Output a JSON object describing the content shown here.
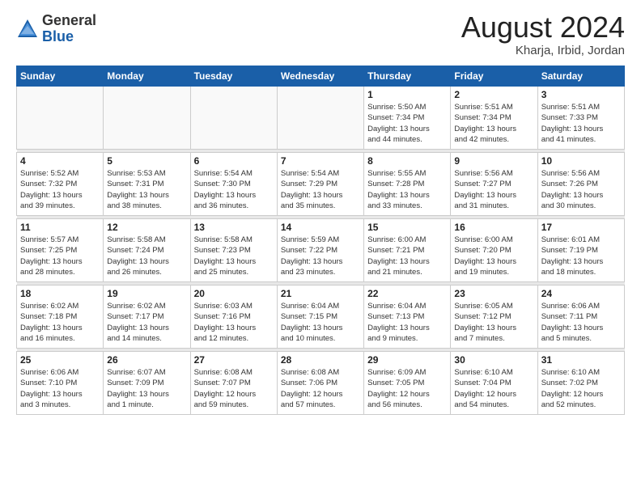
{
  "logo": {
    "general": "General",
    "blue": "Blue"
  },
  "header": {
    "month": "August 2024",
    "location": "Kharja, Irbid, Jordan"
  },
  "weekdays": [
    "Sunday",
    "Monday",
    "Tuesday",
    "Wednesday",
    "Thursday",
    "Friday",
    "Saturday"
  ],
  "weeks": [
    [
      {
        "day": "",
        "info": ""
      },
      {
        "day": "",
        "info": ""
      },
      {
        "day": "",
        "info": ""
      },
      {
        "day": "",
        "info": ""
      },
      {
        "day": "1",
        "info": "Sunrise: 5:50 AM\nSunset: 7:34 PM\nDaylight: 13 hours\nand 44 minutes."
      },
      {
        "day": "2",
        "info": "Sunrise: 5:51 AM\nSunset: 7:34 PM\nDaylight: 13 hours\nand 42 minutes."
      },
      {
        "day": "3",
        "info": "Sunrise: 5:51 AM\nSunset: 7:33 PM\nDaylight: 13 hours\nand 41 minutes."
      }
    ],
    [
      {
        "day": "4",
        "info": "Sunrise: 5:52 AM\nSunset: 7:32 PM\nDaylight: 13 hours\nand 39 minutes."
      },
      {
        "day": "5",
        "info": "Sunrise: 5:53 AM\nSunset: 7:31 PM\nDaylight: 13 hours\nand 38 minutes."
      },
      {
        "day": "6",
        "info": "Sunrise: 5:54 AM\nSunset: 7:30 PM\nDaylight: 13 hours\nand 36 minutes."
      },
      {
        "day": "7",
        "info": "Sunrise: 5:54 AM\nSunset: 7:29 PM\nDaylight: 13 hours\nand 35 minutes."
      },
      {
        "day": "8",
        "info": "Sunrise: 5:55 AM\nSunset: 7:28 PM\nDaylight: 13 hours\nand 33 minutes."
      },
      {
        "day": "9",
        "info": "Sunrise: 5:56 AM\nSunset: 7:27 PM\nDaylight: 13 hours\nand 31 minutes."
      },
      {
        "day": "10",
        "info": "Sunrise: 5:56 AM\nSunset: 7:26 PM\nDaylight: 13 hours\nand 30 minutes."
      }
    ],
    [
      {
        "day": "11",
        "info": "Sunrise: 5:57 AM\nSunset: 7:25 PM\nDaylight: 13 hours\nand 28 minutes."
      },
      {
        "day": "12",
        "info": "Sunrise: 5:58 AM\nSunset: 7:24 PM\nDaylight: 13 hours\nand 26 minutes."
      },
      {
        "day": "13",
        "info": "Sunrise: 5:58 AM\nSunset: 7:23 PM\nDaylight: 13 hours\nand 25 minutes."
      },
      {
        "day": "14",
        "info": "Sunrise: 5:59 AM\nSunset: 7:22 PM\nDaylight: 13 hours\nand 23 minutes."
      },
      {
        "day": "15",
        "info": "Sunrise: 6:00 AM\nSunset: 7:21 PM\nDaylight: 13 hours\nand 21 minutes."
      },
      {
        "day": "16",
        "info": "Sunrise: 6:00 AM\nSunset: 7:20 PM\nDaylight: 13 hours\nand 19 minutes."
      },
      {
        "day": "17",
        "info": "Sunrise: 6:01 AM\nSunset: 7:19 PM\nDaylight: 13 hours\nand 18 minutes."
      }
    ],
    [
      {
        "day": "18",
        "info": "Sunrise: 6:02 AM\nSunset: 7:18 PM\nDaylight: 13 hours\nand 16 minutes."
      },
      {
        "day": "19",
        "info": "Sunrise: 6:02 AM\nSunset: 7:17 PM\nDaylight: 13 hours\nand 14 minutes."
      },
      {
        "day": "20",
        "info": "Sunrise: 6:03 AM\nSunset: 7:16 PM\nDaylight: 13 hours\nand 12 minutes."
      },
      {
        "day": "21",
        "info": "Sunrise: 6:04 AM\nSunset: 7:15 PM\nDaylight: 13 hours\nand 10 minutes."
      },
      {
        "day": "22",
        "info": "Sunrise: 6:04 AM\nSunset: 7:13 PM\nDaylight: 13 hours\nand 9 minutes."
      },
      {
        "day": "23",
        "info": "Sunrise: 6:05 AM\nSunset: 7:12 PM\nDaylight: 13 hours\nand 7 minutes."
      },
      {
        "day": "24",
        "info": "Sunrise: 6:06 AM\nSunset: 7:11 PM\nDaylight: 13 hours\nand 5 minutes."
      }
    ],
    [
      {
        "day": "25",
        "info": "Sunrise: 6:06 AM\nSunset: 7:10 PM\nDaylight: 13 hours\nand 3 minutes."
      },
      {
        "day": "26",
        "info": "Sunrise: 6:07 AM\nSunset: 7:09 PM\nDaylight: 13 hours\nand 1 minute."
      },
      {
        "day": "27",
        "info": "Sunrise: 6:08 AM\nSunset: 7:07 PM\nDaylight: 12 hours\nand 59 minutes."
      },
      {
        "day": "28",
        "info": "Sunrise: 6:08 AM\nSunset: 7:06 PM\nDaylight: 12 hours\nand 57 minutes."
      },
      {
        "day": "29",
        "info": "Sunrise: 6:09 AM\nSunset: 7:05 PM\nDaylight: 12 hours\nand 56 minutes."
      },
      {
        "day": "30",
        "info": "Sunrise: 6:10 AM\nSunset: 7:04 PM\nDaylight: 12 hours\nand 54 minutes."
      },
      {
        "day": "31",
        "info": "Sunrise: 6:10 AM\nSunset: 7:02 PM\nDaylight: 12 hours\nand 52 minutes."
      }
    ]
  ]
}
